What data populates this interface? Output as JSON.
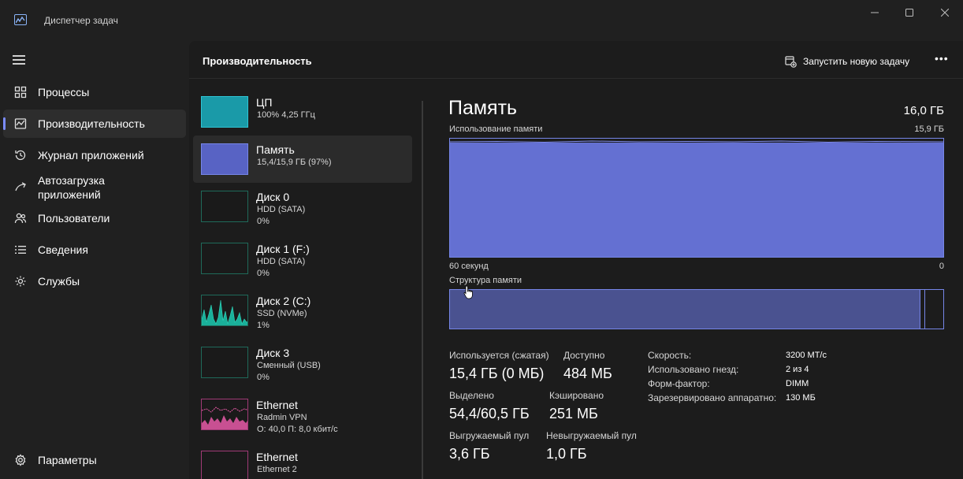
{
  "window": {
    "title": "Диспетчер задач"
  },
  "sidebar": {
    "items": [
      {
        "label": "Процессы",
        "icon": "grid-icon"
      },
      {
        "label": "Производительность",
        "icon": "performance-icon",
        "active": true
      },
      {
        "label": "Журнал приложений",
        "icon": "history-icon"
      },
      {
        "label": "Автозагрузка приложений",
        "icon": "startup-icon"
      },
      {
        "label": "Пользователи",
        "icon": "users-icon"
      },
      {
        "label": "Сведения",
        "icon": "details-icon"
      },
      {
        "label": "Службы",
        "icon": "services-icon"
      }
    ],
    "settings_label": "Параметры"
  },
  "header": {
    "title": "Производительность",
    "run_task_label": "Запустить новую задачу"
  },
  "devices": [
    {
      "name": "ЦП",
      "sub1": "100% 4,25 ГГц",
      "sub2": ""
    },
    {
      "name": "Память",
      "sub1": "15,4/15,9 ГБ (97%)",
      "sub2": ""
    },
    {
      "name": "Диск 0",
      "sub1": "HDD (SATA)",
      "sub2": "0%"
    },
    {
      "name": "Диск 1 (F:)",
      "sub1": "HDD (SATA)",
      "sub2": "0%"
    },
    {
      "name": "Диск 2 (C:)",
      "sub1": "SSD (NVMe)",
      "sub2": "1%"
    },
    {
      "name": "Диск 3",
      "sub1": "Сменный (USB)",
      "sub2": "0%"
    },
    {
      "name": "Ethernet",
      "sub1": "Radmin VPN",
      "sub2": "О: 40,0 П: 8,0 кбит/с"
    },
    {
      "name": "Ethernet",
      "sub1": "Ethernet 2",
      "sub2": ""
    }
  ],
  "detail": {
    "title": "Память",
    "total": "16,0 ГБ",
    "usage_label": "Использование памяти",
    "usage_max": "15,9 ГБ",
    "axis_left": "60 секунд",
    "axis_right": "0",
    "composition_label": "Структура памяти",
    "usage_fraction": 0.97,
    "stats": {
      "in_use_label": "Используется (сжатая)",
      "in_use_value": "15,4 ГБ (0 МБ)",
      "available_label": "Доступно",
      "available_value": "484 МБ",
      "committed_label": "Выделено",
      "committed_value": "54,4/60,5 ГБ",
      "cached_label": "Кэшировано",
      "cached_value": "251 МБ",
      "paged_label": "Выгружаемый пул",
      "paged_value": "3,6 ГБ",
      "nonpaged_label": "Невыгружаемый пул",
      "nonpaged_value": "1,0 ГБ"
    },
    "props": [
      {
        "label": "Скорость:",
        "value": "3200 МТ/с"
      },
      {
        "label": "Использовано гнезд:",
        "value": "2 из 4"
      },
      {
        "label": "Форм-фактор:",
        "value": "DIMM"
      },
      {
        "label": "Зарезервировано аппаратно:",
        "value": "130 МБ"
      }
    ]
  },
  "colors": {
    "accent": "#7b8cff",
    "cpu_graph": "#1a9aa8",
    "memory_graph": "#6470d2",
    "disk_graph": "#1ab09a",
    "network_graph": "#e85aa8"
  }
}
